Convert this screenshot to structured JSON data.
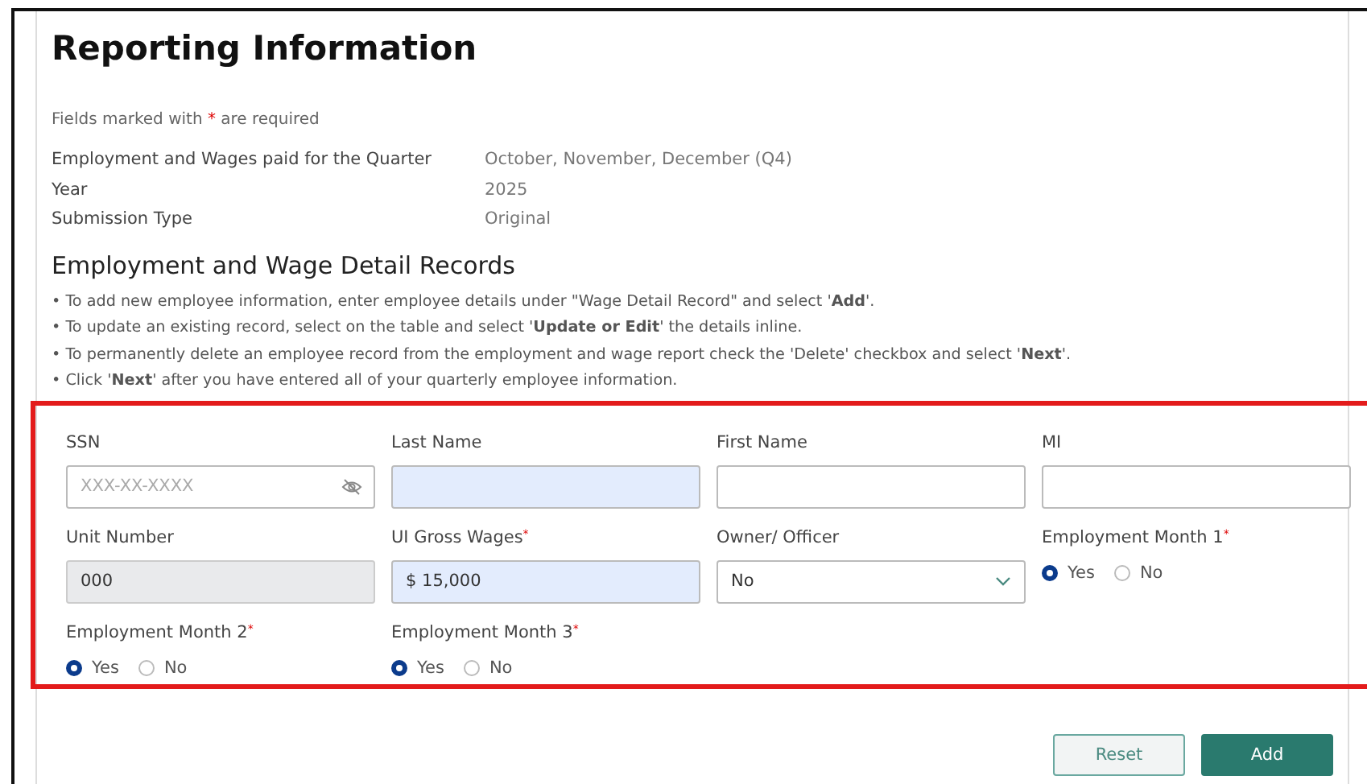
{
  "title": "Reporting Information",
  "required_note": {
    "before": "Fields marked with",
    "mark": "*",
    "after": "are required"
  },
  "summary": [
    {
      "label": "Employment and Wages paid for the Quarter",
      "value": "October, November, December (Q4)"
    },
    {
      "label": "Year",
      "value": "2025"
    },
    {
      "label": "Submission Type",
      "value": "Original"
    }
  ],
  "section_title": "Employment and Wage Detail Records",
  "instructions": [
    "• To add new employee information, enter employee details under \"Wage Detail Record\" and select '**Add**'.",
    "• To update an existing record, select on the table and select '**Update or Edit**' the details inline.",
    "• To permanently delete an employee record from the employment and wage report check the 'Delete' checkbox and select '**Next**'.",
    "• Click '**Next**' after you have entered all of your quarterly employee information."
  ],
  "fields": [
    {
      "kind": "text",
      "label": "SSN",
      "required": false,
      "placeholder": "XXX-XX-XXXX",
      "eye_toggle": true,
      "highlighted": false,
      "disabled": false
    },
    {
      "kind": "text",
      "label": "Last Name",
      "required": false,
      "highlighted": true,
      "disabled": false
    },
    {
      "kind": "text",
      "label": "First Name",
      "required": false,
      "highlighted": false,
      "disabled": false
    },
    {
      "kind": "text",
      "label": "MI",
      "required": false,
      "highlighted": false,
      "disabled": false
    },
    {
      "kind": "text",
      "label": "Unit Number",
      "required": false,
      "value": "000",
      "highlighted": false,
      "disabled": true
    },
    {
      "kind": "text",
      "label": "UI Gross Wages",
      "required": true,
      "value": "$ 15,000",
      "highlighted": true,
      "disabled": false
    },
    {
      "kind": "select",
      "label": "Owner/ Officer",
      "required": false,
      "value": "No",
      "highlighted": false,
      "disabled": false
    },
    {
      "kind": "radio",
      "label": "Employment Month 1",
      "required": true,
      "options": [
        {
          "label": "Yes",
          "selected": true
        },
        {
          "label": "No",
          "selected": false
        }
      ]
    },
    {
      "kind": "radio",
      "label": "Employment Month 2",
      "required": true,
      "options": [
        {
          "label": "Yes",
          "selected": true
        },
        {
          "label": "No",
          "selected": false
        }
      ]
    },
    {
      "kind": "radio",
      "label": "Employment Month 3",
      "required": true,
      "options": [
        {
          "label": "Yes",
          "selected": true
        },
        {
          "label": "No",
          "selected": false
        }
      ]
    }
  ],
  "buttons": [
    {
      "label": "Reset",
      "kind": "secondary"
    },
    {
      "label": "Add",
      "kind": "primary"
    }
  ]
}
